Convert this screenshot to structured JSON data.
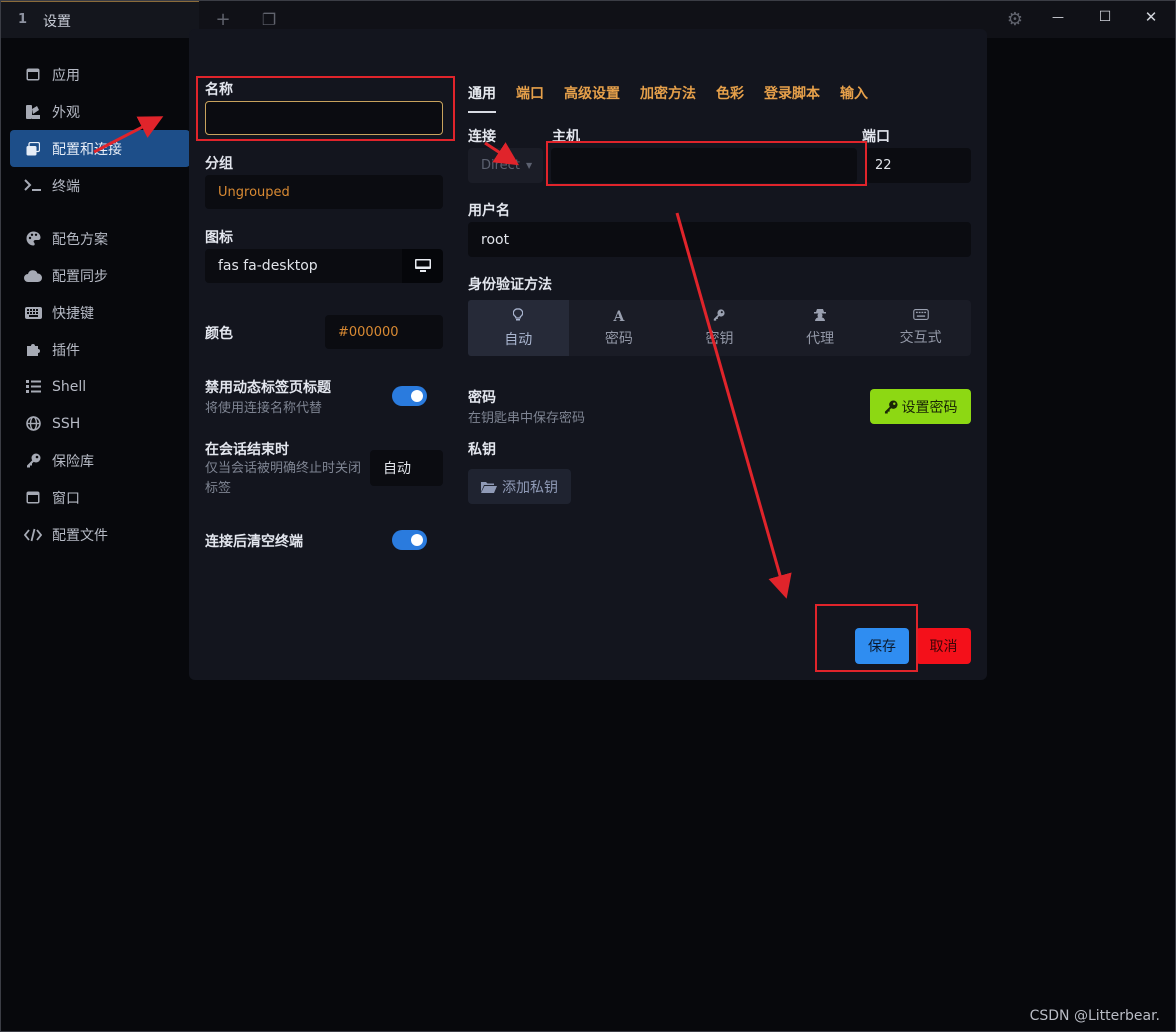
{
  "titlebar": {
    "tab_number": "1",
    "tab_title": "设置",
    "new_tab_symbol": "+",
    "window_symbol": "❐",
    "settings_symbol": "⚙",
    "minimize_symbol": "—",
    "maximize_symbol": "☐",
    "close_symbol": "✕"
  },
  "sidebar": {
    "items": [
      {
        "label": "应用",
        "icon": "window-icon"
      },
      {
        "label": "外观",
        "icon": "palette-swatch-icon"
      },
      {
        "label": "配置和连接",
        "icon": "profiles-icon"
      },
      {
        "label": "终端",
        "icon": "terminal-icon"
      },
      {
        "label": "配色方案",
        "icon": "palette-icon"
      },
      {
        "label": "配置同步",
        "icon": "cloud-icon"
      },
      {
        "label": "快捷键",
        "icon": "keyboard-icon"
      },
      {
        "label": "插件",
        "icon": "puzzle-icon"
      },
      {
        "label": "Shell",
        "icon": "list-icon"
      },
      {
        "label": "SSH",
        "icon": "globe-icon"
      },
      {
        "label": "保险库",
        "icon": "key-icon"
      },
      {
        "label": "窗口",
        "icon": "window-icon"
      },
      {
        "label": "配置文件",
        "icon": "code-icon"
      }
    ]
  },
  "left": {
    "name_label": "名称",
    "name_value": "",
    "group_label": "分组",
    "group_value": "Ungrouped",
    "icon_label": "图标",
    "icon_value": "fas fa-desktop",
    "color_label": "颜色",
    "color_value": "#000000",
    "disable_dynamic_title_label": "禁用动态标签页标题",
    "disable_dynamic_title_desc": "将使用连接名称代替",
    "on_session_end_label": "在会话结束时",
    "on_session_end_desc": "仅当会话被明确终止时关闭标签",
    "on_session_end_value": "自动",
    "clear_terminal_label": "连接后清空终端"
  },
  "tabs": [
    "通用",
    "端口",
    "高级设置",
    "加密方法",
    "色彩",
    "登录脚本",
    "输入"
  ],
  "connection": {
    "connection_label": "连接",
    "connection_value": "Direct",
    "host_label": "主机",
    "host_value": "",
    "port_label": "端口",
    "port_value": "22",
    "username_label": "用户名",
    "username_value": "root"
  },
  "auth": {
    "label": "身份验证方法",
    "options": [
      {
        "label": "自动",
        "icon": "lightbulb-icon"
      },
      {
        "label": "密码",
        "icon": "font-icon"
      },
      {
        "label": "密钥",
        "icon": "key-icon"
      },
      {
        "label": "代理",
        "icon": "user-secret-icon"
      },
      {
        "label": "交互式",
        "icon": "keyboard-icon"
      }
    ]
  },
  "password": {
    "label": "密码",
    "desc": "在钥匙串中保存密码",
    "button": "设置密码"
  },
  "private_key": {
    "label": "私钥",
    "button": "添加私钥"
  },
  "footer": {
    "save": "保存",
    "cancel": "取消"
  },
  "colors": {
    "accent": "#2a7bde",
    "orange": "#e6a04a",
    "green_button": "#8dd813",
    "cancel_red": "#f4101a",
    "annotation_red": "#e0242b"
  },
  "watermark": "CSDN @Litterbear."
}
